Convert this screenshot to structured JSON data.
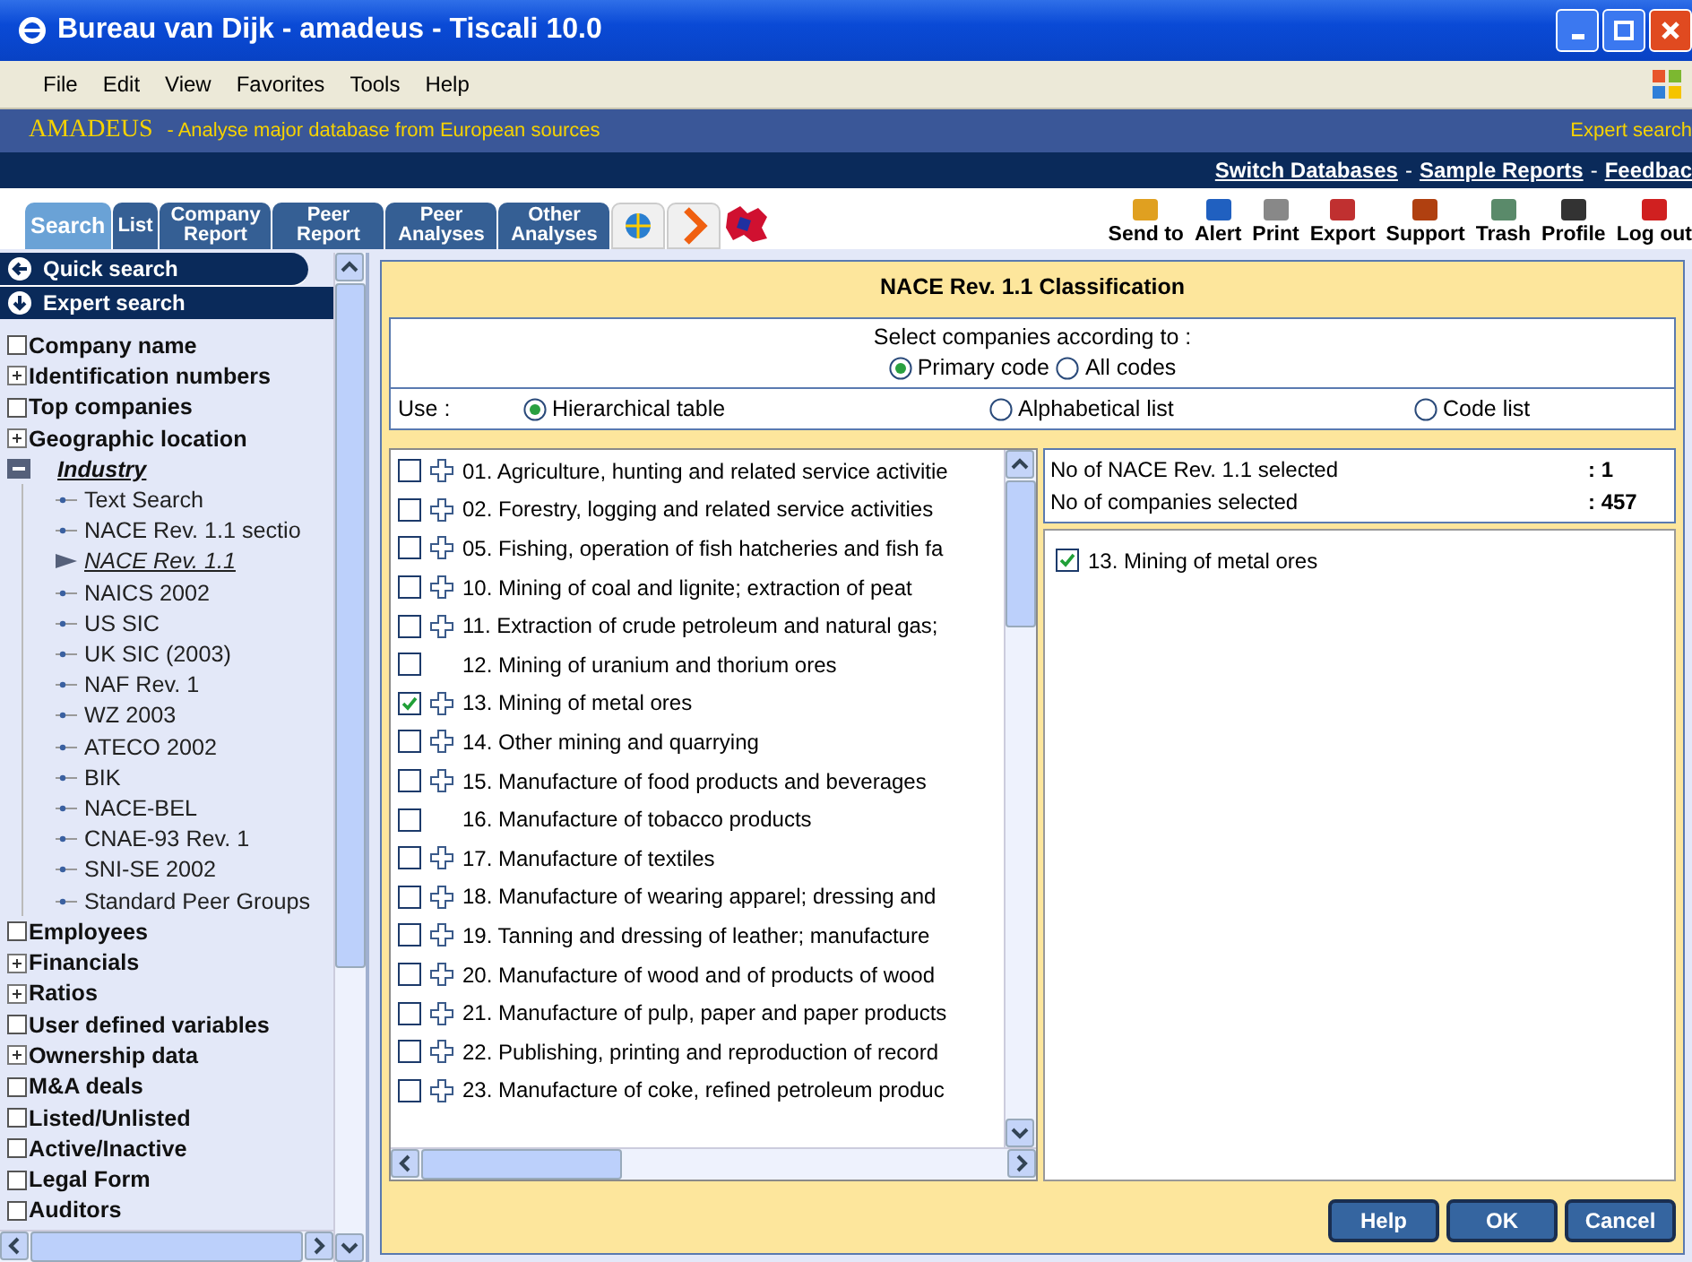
{
  "window": {
    "title": "Bureau van Dijk - amadeus - Tiscali 10.0"
  },
  "menu": [
    "File",
    "Edit",
    "View",
    "Favorites",
    "Tools",
    "Help"
  ],
  "banner": {
    "brand": "AMADEUS",
    "tagline": "- Analyse major database from European sources",
    "right": "Expert search"
  },
  "links": {
    "separator": "-",
    "items": [
      {
        "label": "Switch Databases"
      },
      {
        "label": "Sample Reports"
      },
      {
        "label": "Feedbac"
      }
    ]
  },
  "tabs": [
    {
      "label": "Search",
      "selected": true
    },
    {
      "label": "List",
      "selected": false
    },
    {
      "label": "Company Report",
      "selected": false
    },
    {
      "label": "Peer Report",
      "selected": false
    },
    {
      "label": "Peer Analyses",
      "selected": false
    },
    {
      "label": "Other Analyses",
      "selected": false
    }
  ],
  "tools": [
    "Send to",
    "Alert",
    "Print",
    "Export",
    "Support",
    "Trash",
    "Profile",
    "Log out"
  ],
  "sidebar": {
    "modes": [
      {
        "label": "Quick search",
        "selected": false
      },
      {
        "label": "Expert search",
        "selected": true
      }
    ],
    "items": [
      {
        "label": "Company name",
        "kind": "checkbox",
        "checked": false,
        "selected": false
      },
      {
        "label": "Identification numbers",
        "kind": "expandable",
        "expanded": false,
        "selected": false
      },
      {
        "label": "Top companies",
        "kind": "checkbox",
        "checked": false,
        "selected": false
      },
      {
        "label": "Geographic location",
        "kind": "expandable",
        "expanded": false,
        "selected": false
      },
      {
        "label": "Industry",
        "kind": "expandable",
        "expanded": true,
        "selected": true,
        "children": [
          {
            "label": "Text Search",
            "selected": false
          },
          {
            "label": "NACE Rev. 1.1 sectio",
            "selected": false
          },
          {
            "label": "NACE Rev. 1.1",
            "selected": true
          },
          {
            "label": "NAICS 2002",
            "selected": false
          },
          {
            "label": "US SIC",
            "selected": false
          },
          {
            "label": "UK SIC (2003)",
            "selected": false
          },
          {
            "label": "NAF Rev. 1",
            "selected": false
          },
          {
            "label": "WZ 2003",
            "selected": false
          },
          {
            "label": "ATECO 2002",
            "selected": false
          },
          {
            "label": "BIK",
            "selected": false
          },
          {
            "label": "NACE-BEL",
            "selected": false
          },
          {
            "label": "CNAE-93 Rev. 1",
            "selected": false
          },
          {
            "label": "SNI-SE 2002",
            "selected": false
          },
          {
            "label": "Standard Peer Groups",
            "selected": false
          }
        ]
      },
      {
        "label": "Employees",
        "kind": "checkbox",
        "checked": false,
        "selected": false
      },
      {
        "label": "Financials",
        "kind": "expandable",
        "expanded": false,
        "selected": false
      },
      {
        "label": "Ratios",
        "kind": "expandable",
        "expanded": false,
        "selected": false
      },
      {
        "label": "User defined variables",
        "kind": "checkbox",
        "checked": false,
        "selected": false
      },
      {
        "label": "Ownership data",
        "kind": "expandable",
        "expanded": false,
        "selected": false
      },
      {
        "label": "M&A deals",
        "kind": "checkbox",
        "checked": false,
        "selected": false
      },
      {
        "label": "Listed/Unlisted",
        "kind": "checkbox",
        "checked": false,
        "selected": false
      },
      {
        "label": "Active/Inactive",
        "kind": "checkbox",
        "checked": false,
        "selected": false
      },
      {
        "label": "Legal Form",
        "kind": "checkbox",
        "checked": false,
        "selected": false
      },
      {
        "label": "Auditors",
        "kind": "checkbox",
        "checked": false,
        "selected": false
      }
    ]
  },
  "panel": {
    "title": "NACE Rev. 1.1 Classification",
    "select_label": "Select companies according to :",
    "code_options": [
      {
        "label": "Primary code",
        "selected": true
      },
      {
        "label": "All codes",
        "selected": false
      }
    ],
    "use_label": "Use :",
    "use_options": [
      {
        "label": "Hierarchical table",
        "selected": true
      },
      {
        "label": "Alphabetical list",
        "selected": false
      },
      {
        "label": "Code list",
        "selected": false
      }
    ],
    "codes": [
      {
        "label": "01. Agriculture, hunting and related service activitie",
        "checked": false,
        "expandable": true
      },
      {
        "label": "02. Forestry, logging and related service activities",
        "checked": false,
        "expandable": true
      },
      {
        "label": "05. Fishing, operation of fish hatcheries and fish fa",
        "checked": false,
        "expandable": true
      },
      {
        "label": "10. Mining of coal and lignite; extraction of peat",
        "checked": false,
        "expandable": true
      },
      {
        "label": "11. Extraction of crude petroleum and natural gas;",
        "checked": false,
        "expandable": true
      },
      {
        "label": "12. Mining of uranium and thorium ores",
        "checked": false,
        "expandable": false
      },
      {
        "label": "13. Mining of metal ores",
        "checked": true,
        "expandable": true
      },
      {
        "label": "14. Other mining and quarrying",
        "checked": false,
        "expandable": true
      },
      {
        "label": "15. Manufacture of food products and beverages",
        "checked": false,
        "expandable": true
      },
      {
        "label": "16. Manufacture of tobacco products",
        "checked": false,
        "expandable": false
      },
      {
        "label": "17. Manufacture of textiles",
        "checked": false,
        "expandable": true
      },
      {
        "label": "18. Manufacture of wearing apparel; dressing and",
        "checked": false,
        "expandable": true
      },
      {
        "label": "19. Tanning and dressing of leather; manufacture",
        "checked": false,
        "expandable": true
      },
      {
        "label": "20. Manufacture of wood and of products of wood",
        "checked": false,
        "expandable": true
      },
      {
        "label": "21. Manufacture of pulp, paper and paper products",
        "checked": false,
        "expandable": true
      },
      {
        "label": "22. Publishing, printing and reproduction of record",
        "checked": false,
        "expandable": true
      },
      {
        "label": "23. Manufacture of coke, refined petroleum produc",
        "checked": false,
        "expandable": true
      }
    ],
    "stats": [
      {
        "label": "No of NACE Rev. 1.1 selected",
        "value": ": 1"
      },
      {
        "label": "No of companies selected",
        "value": ": 457"
      }
    ],
    "selected": [
      {
        "label": "13. Mining of metal ores",
        "checked": true
      }
    ],
    "buttons": [
      "Help",
      "OK",
      "Cancel"
    ]
  }
}
